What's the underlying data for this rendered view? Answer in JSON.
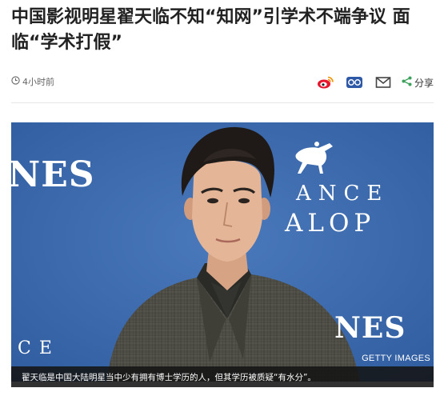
{
  "article": {
    "headline": "中国影视明星翟天临不知“知网”引学术不端争议 面临“学术打假”",
    "time_ago": "4小时前"
  },
  "toolbar": {
    "share_label": "分享",
    "icons": [
      "clock-icon",
      "weibo-icon",
      "wechat-moments-icon",
      "email-icon",
      "share-icon"
    ]
  },
  "photo": {
    "backdrop_text_left": "NES",
    "backdrop_text_right_line1": "ANCE",
    "backdrop_text_right_line2": "ALOP",
    "backdrop_text_bottom_right": "NES",
    "backdrop_text_bottom_left": "CE",
    "credit": "GETTY IMAGES",
    "caption": "翟天临是中国大陆明星当中少有拥有博士学历的人，但其学历被质疑“有水分”。"
  },
  "colors": {
    "backdrop_blue": "#3c6bae",
    "share_icon_green": "#3aa05a",
    "weibo_red": "#e6162d"
  }
}
